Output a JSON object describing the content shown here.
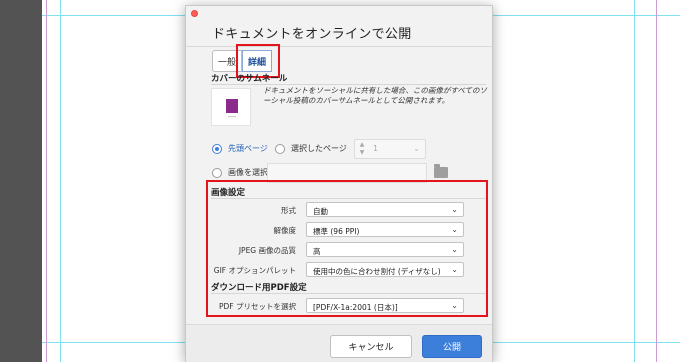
{
  "dialog": {
    "title": "ドキュメントをオンラインで公開",
    "tabs": {
      "basic": "一般",
      "advanced": "詳細"
    },
    "cover": {
      "label": "カバーのサムネール",
      "description": "ドキュメントをソーシャルに共有した場合、この画像がすべてのソーシャル投稿のカバーサムネールとして公開されます。",
      "first_page": "先頭ページ",
      "selected_page": "選択したページ",
      "page_value": "1",
      "choose_image": "画像を選択"
    },
    "image_settings": {
      "label": "画像設定",
      "format_label": "形式",
      "format_value": "自動",
      "resolution_label": "解像度",
      "resolution_value": "標準 (96 PPI)",
      "jpeg_label": "JPEG 画像の品質",
      "jpeg_value": "高",
      "gif_label": "GIF オプションパレット",
      "gif_value": "使用中の色に合わせ割付 (ディザなし)"
    },
    "download": {
      "label": "ダウンロード用PDF設定",
      "preset_label": "PDF プリセットを選択",
      "preset_value": "[PDF/X-1a:2001 (日本)]"
    },
    "buttons": {
      "cancel": "キャンセル",
      "publish": "公開"
    }
  },
  "colors": {
    "accent": "#3c7fdb",
    "highlight": "#e3141e",
    "guide": "#7fe0f0",
    "thumbnail_cover": "#8a2a8c"
  },
  "icons": {
    "close": "close-dot-icon",
    "folder": "folder-icon",
    "chevron": "chevron-down-icon",
    "stepper": "stepper-arrows-icon"
  }
}
